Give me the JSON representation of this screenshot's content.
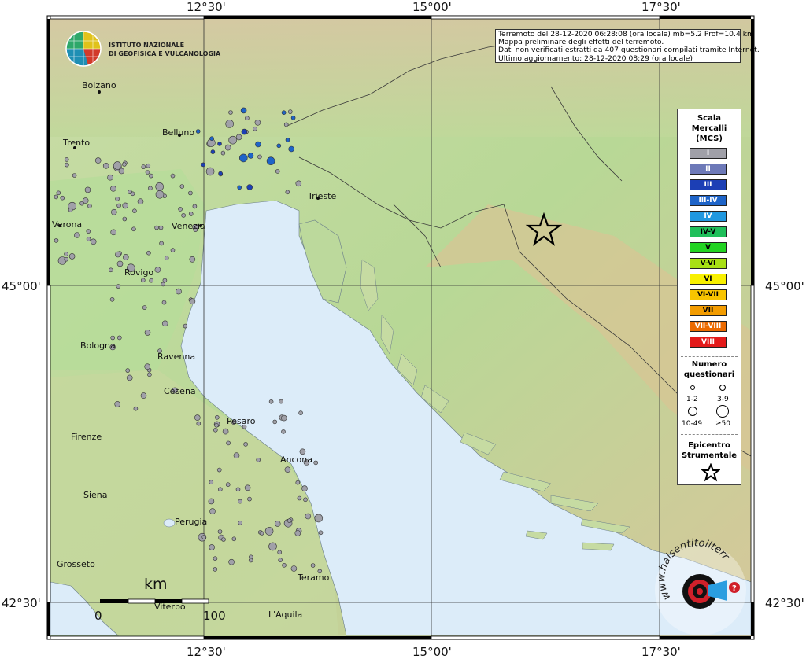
{
  "map": {
    "longitude_labels": [
      "12°30'",
      "15°00'",
      "17°30'"
    ],
    "latitude_labels": [
      "45°00'",
      "42°30'"
    ],
    "epicenter_symbol": "star",
    "colors": {
      "sea": "#dcecf9",
      "land_low": "#b9d89a",
      "land_high": "#d8c59a",
      "grid": "#333333"
    }
  },
  "institute": {
    "name_line1": "ISTITUTO NAZIONALE",
    "name_line2": "DI GEOFISICA E VULCANOLOGIA"
  },
  "info": {
    "line1": "Terremoto del 28-12-2020 06:28:08 (ora locale) mb=5.2 Prof=10.4 km",
    "line2": "Mappa preliminare degli effetti del terremoto.",
    "line3": "Dati non verificati estratti da 407 questionari compilati tramite Internet.",
    "line4": "Ultimo aggiornamento: 28-12-2020 08:29 (ora locale)"
  },
  "cities": [
    {
      "name": "Bolzano"
    },
    {
      "name": "Belluno"
    },
    {
      "name": "Trento"
    },
    {
      "name": "Verona"
    },
    {
      "name": "Venezia"
    },
    {
      "name": "Trieste"
    },
    {
      "name": "Rovigo"
    },
    {
      "name": "Bologna"
    },
    {
      "name": "Ravenna"
    },
    {
      "name": "Cesena"
    },
    {
      "name": "Firenze"
    },
    {
      "name": "Pesaro"
    },
    {
      "name": "Ancona"
    },
    {
      "name": "Siena"
    },
    {
      "name": "Perugia"
    },
    {
      "name": "Grosseto"
    },
    {
      "name": "Teramo"
    },
    {
      "name": "Viterbo"
    },
    {
      "name": "L'Aquila"
    }
  ],
  "legend": {
    "title_line1": "Scala",
    "title_line2": "Mercalli",
    "title_line3": "(MCS)",
    "scale": [
      {
        "label": "I",
        "color": "#a0a0a8"
      },
      {
        "label": "II",
        "color": "#6d79b8"
      },
      {
        "label": "III",
        "color": "#1c3fb5"
      },
      {
        "label": "III-IV",
        "color": "#1e64c8"
      },
      {
        "label": "IV",
        "color": "#1f98e0"
      },
      {
        "label": "IV-V",
        "color": "#1fbf5a"
      },
      {
        "label": "V",
        "color": "#22d322"
      },
      {
        "label": "V-VI",
        "color": "#a8e014"
      },
      {
        "label": "VI",
        "color": "#f8f000"
      },
      {
        "label": "VI-VII",
        "color": "#f8c400"
      },
      {
        "label": "VII",
        "color": "#f39c00"
      },
      {
        "label": "VII-VIII",
        "color": "#ec6a00"
      },
      {
        "label": "VIII",
        "color": "#e31a1a"
      }
    ],
    "count_title_line1": "Numero",
    "count_title_line2": "questionari",
    "count_1": "1-2",
    "count_2": "3-9",
    "count_3": "10-49",
    "count_4": "≥50",
    "epi_title_line1": "Epicentro",
    "epi_title_line2": "Strumentale"
  },
  "scalebar": {
    "unit": "km",
    "start": "0",
    "end": "100"
  },
  "watermark": {
    "text": "www.haisentitoilterremoto.it",
    "badge": "?"
  }
}
